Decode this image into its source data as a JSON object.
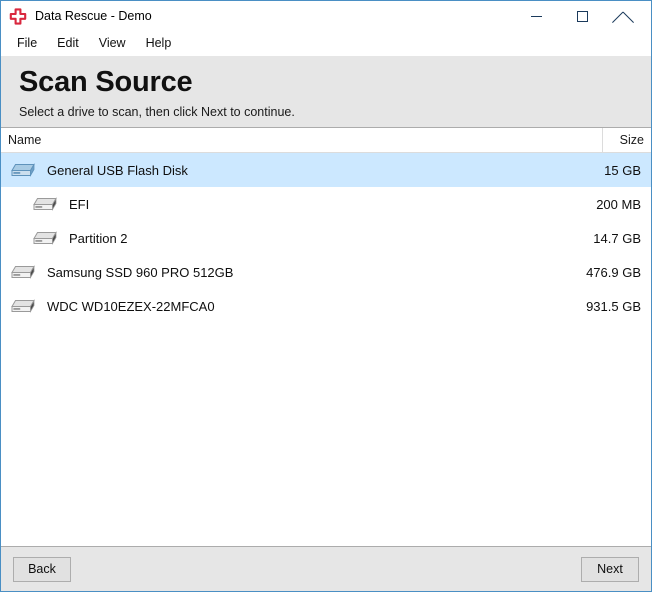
{
  "window": {
    "title": "Data Rescue - Demo",
    "app_icon": "red-cross-icon",
    "controls": {
      "minimize": "minimize-icon",
      "maximize": "maximize-icon",
      "close": "close-icon"
    }
  },
  "menubar": {
    "items": [
      {
        "label": "File"
      },
      {
        "label": "Edit"
      },
      {
        "label": "View"
      },
      {
        "label": "Help"
      }
    ]
  },
  "header": {
    "title": "Scan Source",
    "subtitle": "Select a drive to scan, then click Next to continue."
  },
  "list": {
    "columns": {
      "name": "Name",
      "size": "Size"
    },
    "rows": [
      {
        "name": "General USB Flash Disk",
        "size": "15 GB",
        "icon": "external-drive-icon",
        "child": false,
        "selected": true
      },
      {
        "name": "EFI",
        "size": "200 MB",
        "icon": "partition-drive-icon",
        "child": true,
        "selected": false
      },
      {
        "name": "Partition 2",
        "size": "14.7 GB",
        "icon": "partition-drive-icon",
        "child": true,
        "selected": false
      },
      {
        "name": "Samsung SSD 960 PRO 512GB",
        "size": "476.9 GB",
        "icon": "internal-drive-icon",
        "child": false,
        "selected": false
      },
      {
        "name": "WDC WD10EZEX-22MFCA0",
        "size": "931.5 GB",
        "icon": "internal-drive-icon",
        "child": false,
        "selected": false
      }
    ]
  },
  "footer": {
    "back_label": "Back",
    "next_label": "Next"
  },
  "colors": {
    "selection": "#cce8ff",
    "header_bg": "#e6e6e6",
    "window_border": "#4a8fc4",
    "app_icon_red": "#d9273e"
  }
}
